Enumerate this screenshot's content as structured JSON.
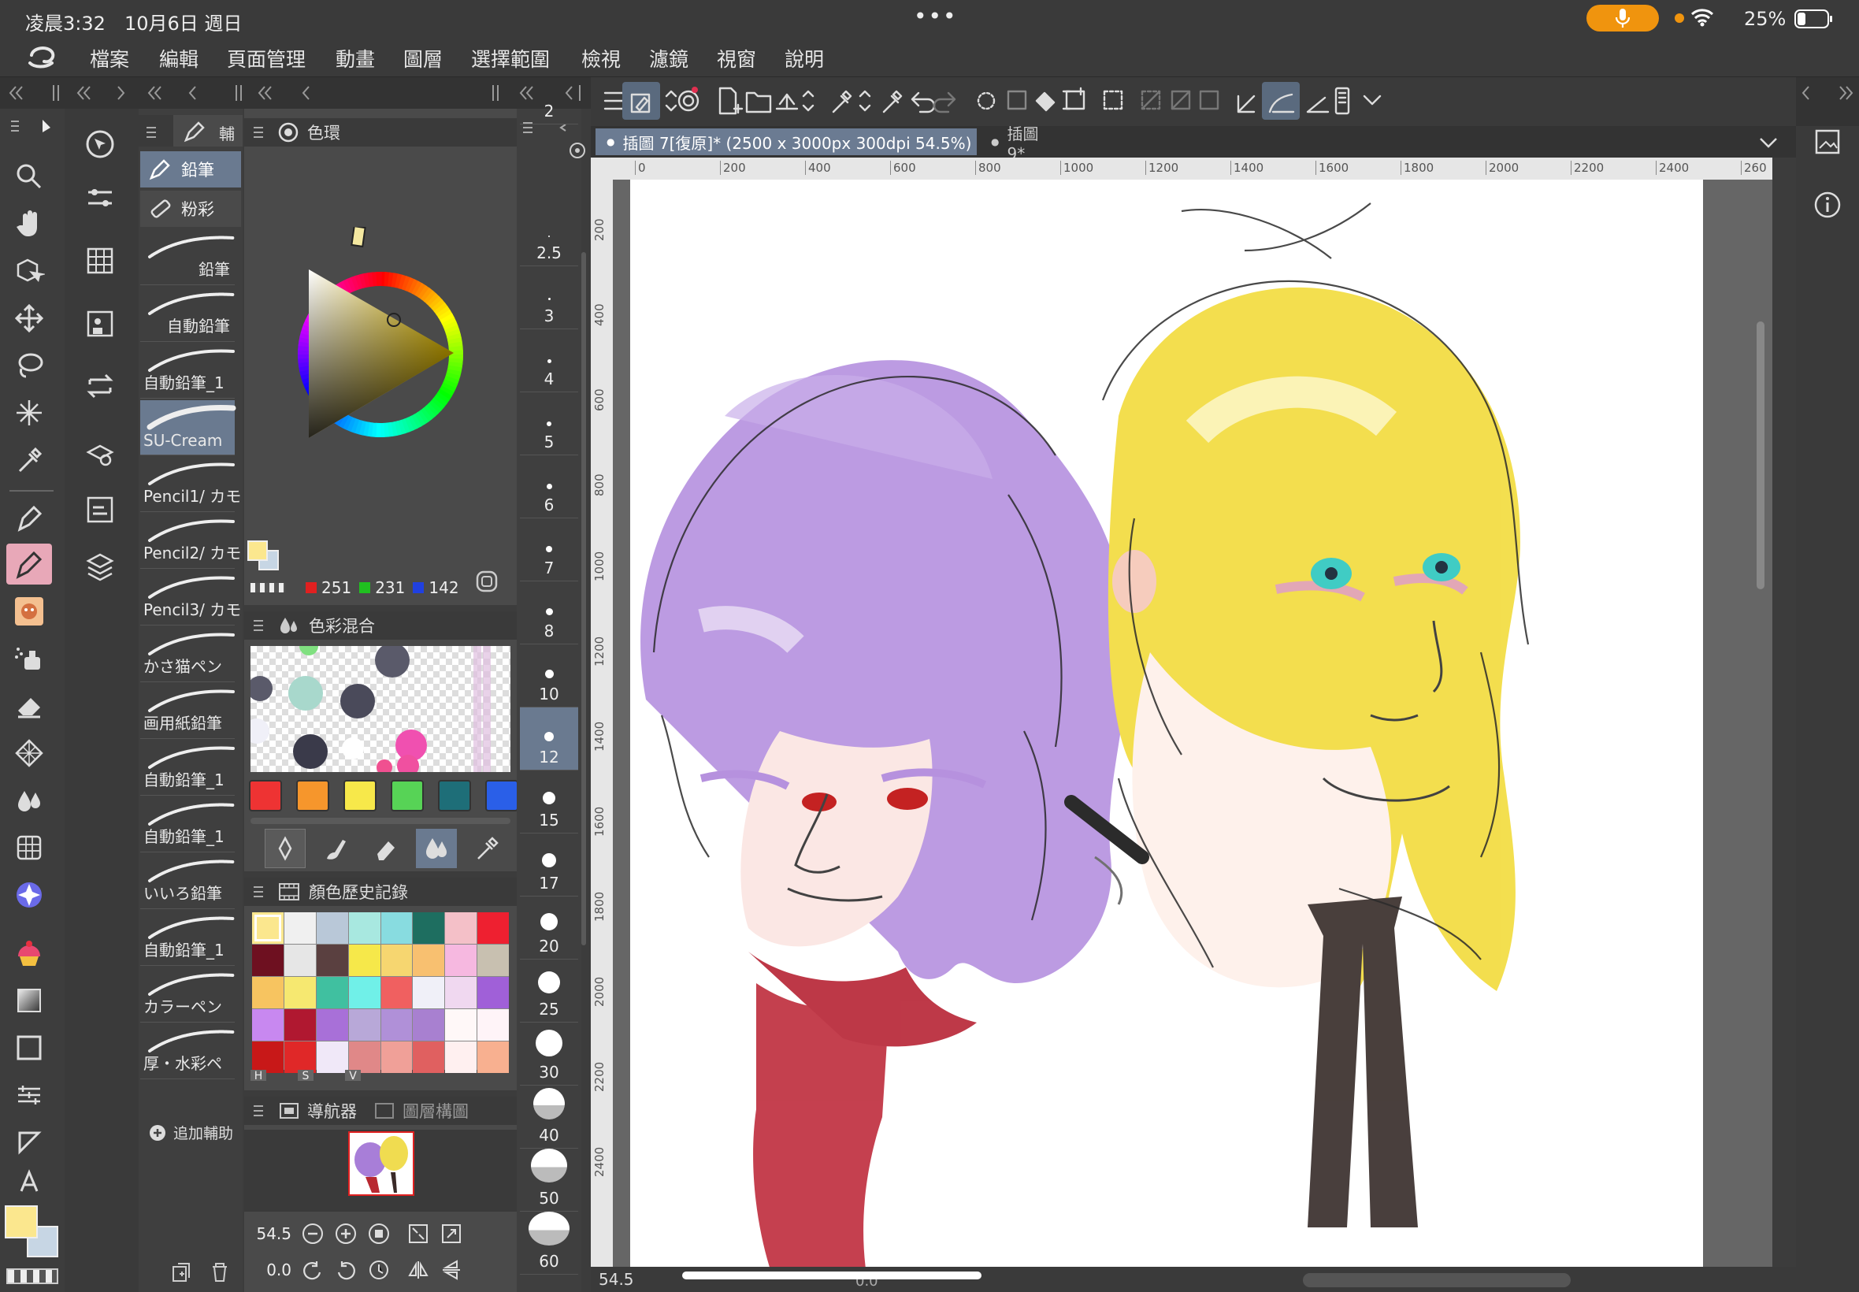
{
  "status": {
    "time": "凌晨3:32",
    "date": "10月6日 週日",
    "battery": "25%",
    "dots": "•••"
  },
  "menu": [
    "檔案",
    "編輯",
    "頁面管理",
    "動畫",
    "圖層",
    "選擇範圍",
    "檢視",
    "濾鏡",
    "視窗",
    "說明"
  ],
  "subtool": {
    "tabs": [
      "鉛筆",
      "粉彩"
    ],
    "header": "輔",
    "items": [
      "鉛筆",
      "自動鉛筆",
      "自動鉛筆_1",
      "SU-Cream",
      "Pencil1/ カモ",
      "Pencil2/ カモ",
      "Pencil3/ カモ",
      "かさ猫ペン",
      "画用紙鉛筆",
      "自動鉛筆_1",
      "自動鉛筆_1",
      "いいろ鉛筆",
      "自動鉛筆_1",
      "カラーペン",
      "厚・水彩ペ"
    ],
    "add_label": "追加輔助"
  },
  "color_wheel": {
    "title": "色環",
    "r": "251",
    "g": "231",
    "b": "142",
    "main_color": "#fbe78e",
    "sub_color": "#c7d6e4"
  },
  "color_mix": {
    "title": "色彩混合",
    "palette": [
      "#ee3333",
      "#f6962c",
      "#f7e84a",
      "#57d356",
      "#1e6e78",
      "#2a5fe8"
    ]
  },
  "history": {
    "title": "顏色歷史記錄",
    "hsv": [
      "H",
      "S",
      "V"
    ],
    "colors": [
      "#fbe78e",
      "#f0f0f0",
      "#b9c8d8",
      "#a8e8e0",
      "#88dce0",
      "#1e6e60",
      "#f4c0c8",
      "#ee2030",
      "#6e1020",
      "#e6e6e6",
      "#5a4040",
      "#f6e84a",
      "#f6d670",
      "#f8c070",
      "#f6b8e0",
      "#c8c0b0",
      "#f7c460",
      "#f6e870",
      "#40c0a0",
      "#70f0e8",
      "#f06060",
      "#f0f0f8",
      "#f0d8f0",
      "#a060d8",
      "#c888f0",
      "#b01830",
      "#a870d8",
      "#b8a8d8",
      "#b090d8",
      "#a880d0",
      "#fff8f8",
      "#fff4f8",
      "#c81818",
      "#e02828",
      "#f0e8f8",
      "#e08888",
      "#f0a098",
      "#e06060",
      "#fff0f0",
      "#f8b090"
    ]
  },
  "navigator": {
    "title": "導航器",
    "tab2": "圖層構圖",
    "zoom": "54.5",
    "angle": "0.0"
  },
  "brush_sizes": [
    "2",
    "2.5",
    "3",
    "4",
    "5",
    "6",
    "7",
    "8",
    "10",
    "12",
    "15",
    "17",
    "20",
    "25",
    "30",
    "40",
    "50",
    "60"
  ],
  "document": {
    "tab1": "插圖 7[復原]* (2500 x 3000px 300dpi 54.5%)",
    "tab2": "插圖 9*",
    "ruler_x": [
      "0",
      "200",
      "400",
      "600",
      "800",
      "1000",
      "1200",
      "1400",
      "1600",
      "1800",
      "2000",
      "2200",
      "2400",
      "260"
    ],
    "ruler_y": [
      "200",
      "400",
      "600",
      "800",
      "1000",
      "1200",
      "1400",
      "1600",
      "1800",
      "2000",
      "2200",
      "2400"
    ],
    "status_zoom": "54.5",
    "status_angle": "0.0"
  }
}
